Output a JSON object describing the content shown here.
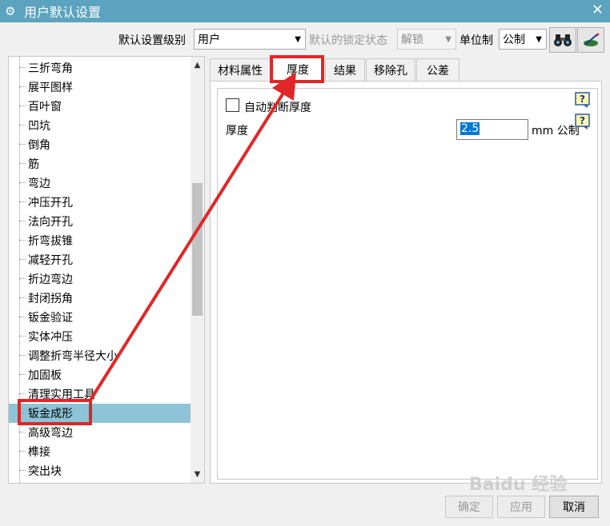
{
  "window": {
    "title": "用户默认设置",
    "gear_icon": "gear-icon",
    "close_glyph": "✕"
  },
  "toolbar": {
    "level_label": "默认设置级别",
    "level_value": "用户",
    "lock_label": "默认的锁定状态",
    "lock_value": "解锁",
    "unit_label": "单位制",
    "unit_value": "公制",
    "btn1_icon": "binoculars-icon",
    "btn2_icon": "wizard-icon"
  },
  "tree": {
    "items": [
      "三折弯角",
      "展平图样",
      "百叶窗",
      "凹坑",
      "倒角",
      "筋",
      "弯边",
      "冲压开孔",
      "法向开孔",
      "折弯拔锥",
      "减轻开孔",
      "折边弯边",
      "封闭拐角",
      "钣金验证",
      "实体冲压",
      "调整折弯半径大小",
      "加固板",
      "清理实用工具",
      "钣金成形",
      "高级弯边",
      "榫接",
      "突出块"
    ],
    "selected_index": 18
  },
  "tabs": [
    "材料属性",
    "厚度",
    "结果",
    "移除孔",
    "公差"
  ],
  "active_tab_index": 1,
  "thickness": {
    "auto_label": "自动判断厚度",
    "auto_checked": false,
    "label": "厚度",
    "value": "2.5",
    "unit": "mm 公制",
    "help_icon": "help-icon"
  },
  "buttons": {
    "ok": "确定",
    "apply": "应用",
    "cancel": "取消"
  },
  "colors": {
    "titlebar": "#5ba3be",
    "selection": "#8ec4d7",
    "annotation": "#e02727"
  },
  "watermark": "Baidu 经验"
}
